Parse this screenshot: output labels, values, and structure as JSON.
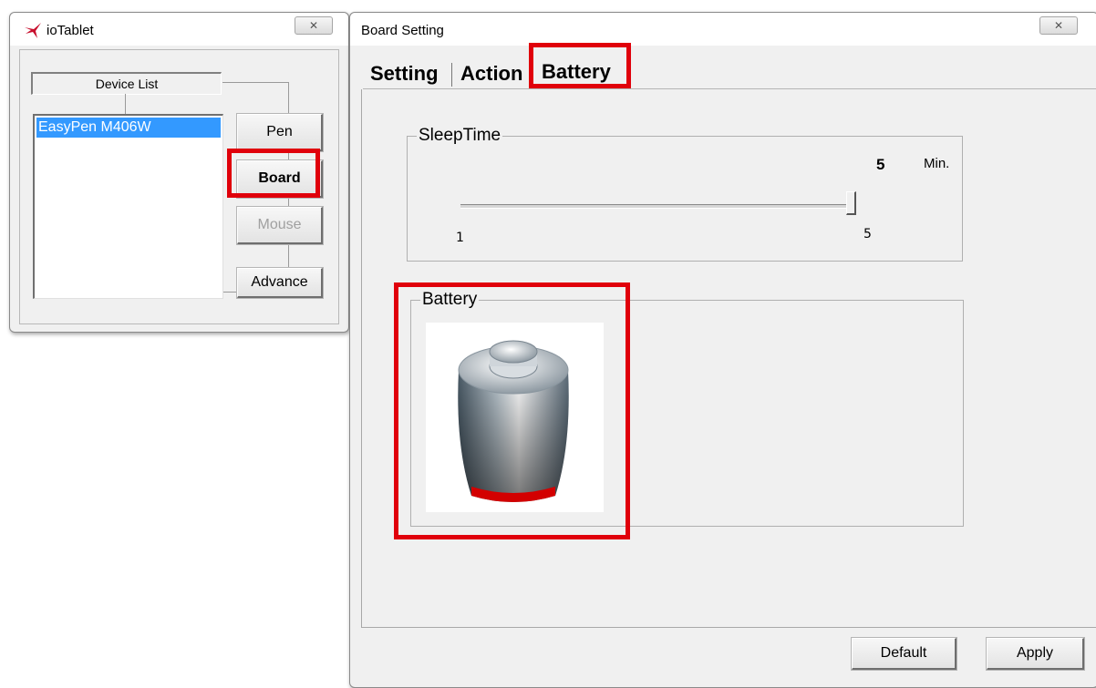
{
  "left_window": {
    "title": "ioTablet",
    "close_icon": "close-icon",
    "device_list_header": "Device List",
    "devices": [
      "EasyPen M406W"
    ],
    "buttons": {
      "pen": "Pen",
      "board": "Board",
      "mouse": "Mouse",
      "advance": "Advance"
    }
  },
  "board_window": {
    "title": "Board Setting",
    "close_icon": "close-icon",
    "tabs": [
      "Setting",
      "Action",
      "Battery"
    ],
    "active_tab": "Battery",
    "sleep_time": {
      "label": "SleepTime",
      "value": "5",
      "unit": "Min.",
      "min_label": "1",
      "max_label": "5",
      "slider_fraction": 1.0
    },
    "battery": {
      "label": "Battery",
      "icon": "battery-icon",
      "level_color": "#d30000"
    },
    "buttons": {
      "default": "Default",
      "apply": "Apply"
    }
  },
  "colors": {
    "highlight": "#e0000b",
    "selection": "#3399ff"
  }
}
